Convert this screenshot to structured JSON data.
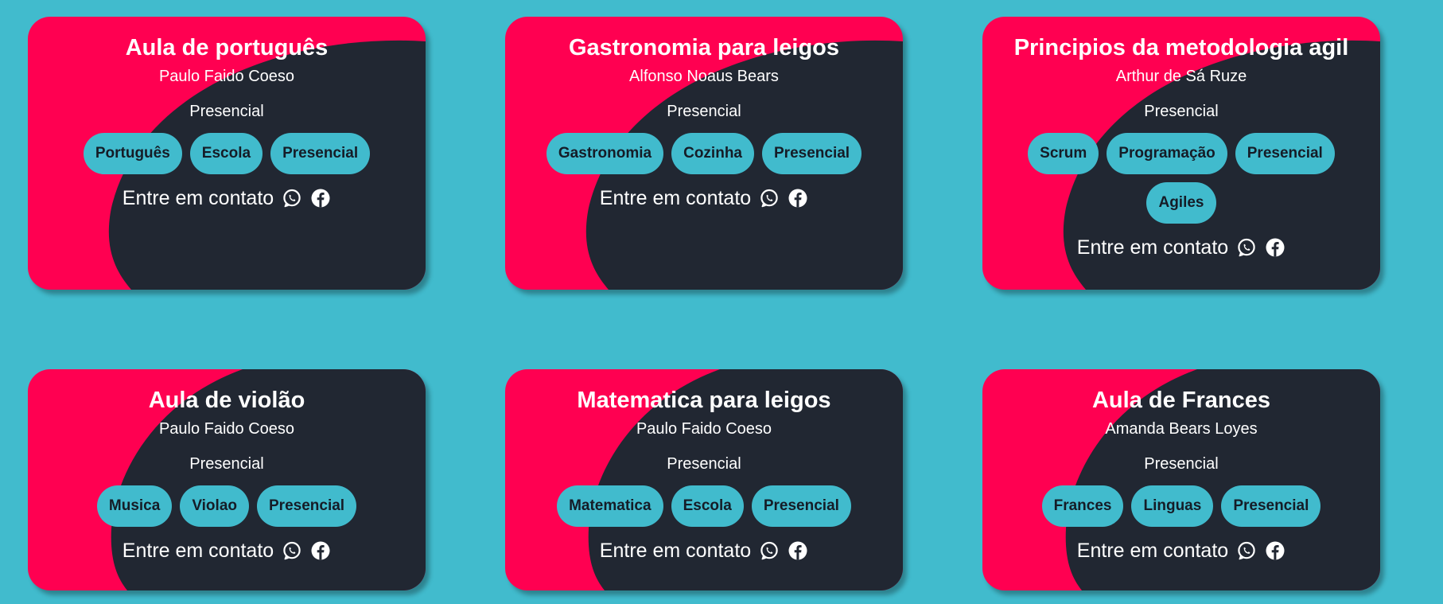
{
  "colors": {
    "page_background": "#41bbcd",
    "card_accent": "#ff0051",
    "card_dark": "#212732",
    "tag_background": "#41bbcd",
    "tag_text": "#151c27",
    "text": "#ffffff"
  },
  "contact_label": "Entre em contato",
  "icons": [
    "whatsapp-icon",
    "facebook-icon"
  ],
  "cards": [
    {
      "title": "Aula de português",
      "teacher": "Paulo Faido Coeso",
      "modality": "Presencial",
      "tags": [
        "Português",
        "Escola",
        "Presencial"
      ]
    },
    {
      "title": "Gastronomia para leigos",
      "teacher": "Alfonso Noaus Bears",
      "modality": "Presencial",
      "tags": [
        "Gastronomia",
        "Cozinha",
        "Presencial"
      ]
    },
    {
      "title": "Principios da metodologia agil",
      "teacher": "Arthur de Sá Ruze",
      "modality": "Presencial",
      "tags": [
        "Scrum",
        "Programação",
        "Presencial",
        "Agiles"
      ]
    },
    {
      "title": "Aula de violão",
      "teacher": "Paulo Faido Coeso",
      "modality": "Presencial",
      "tags": [
        "Musica",
        "Violao",
        "Presencial"
      ]
    },
    {
      "title": "Matematica para leigos",
      "teacher": "Paulo Faido Coeso",
      "modality": "Presencial",
      "tags": [
        "Matematica",
        "Escola",
        "Presencial"
      ]
    },
    {
      "title": "Aula de Frances",
      "teacher": "Amanda Bears Loyes",
      "modality": "Presencial",
      "tags": [
        "Frances",
        "Linguas",
        "Presencial"
      ]
    }
  ]
}
